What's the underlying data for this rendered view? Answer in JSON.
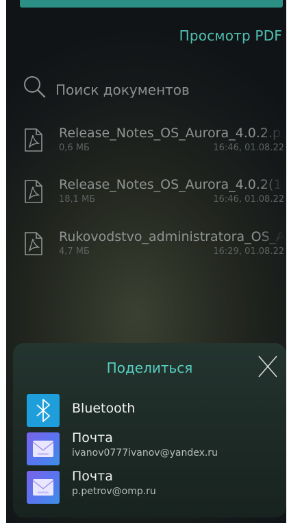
{
  "header": {
    "title": "Просмотр PDF"
  },
  "search": {
    "placeholder": "Поиск документов"
  },
  "documents": [
    {
      "name": "Release_Notes_OS_Aurora_4.0.2.p",
      "size": "0,6 МБ",
      "date": "16:46, 01.08.22"
    },
    {
      "name": "Release_Notes_OS_Aurora_4.0.2(1",
      "size": "18,1 МБ",
      "date": "16:46, 01.08.22"
    },
    {
      "name": "Rukovodstvo_administratora_OS_A",
      "size": "4,7 МБ",
      "date": "16:29, 01.08.22"
    }
  ],
  "share": {
    "title": "Поделиться",
    "items": [
      {
        "label": "Bluetooth",
        "icon": "bluetooth-icon"
      },
      {
        "label": "Почта",
        "account": "ivanov0777ivanov@yandex.ru",
        "icon": "mail-icon"
      },
      {
        "label": "Почта",
        "account": "p.petrov@omp.ru",
        "icon": "mail-icon"
      }
    ]
  },
  "colors": {
    "accent": "#4fc0b3",
    "bluetooth": "#1e9fdc",
    "sheet": "#1f2e2a"
  }
}
